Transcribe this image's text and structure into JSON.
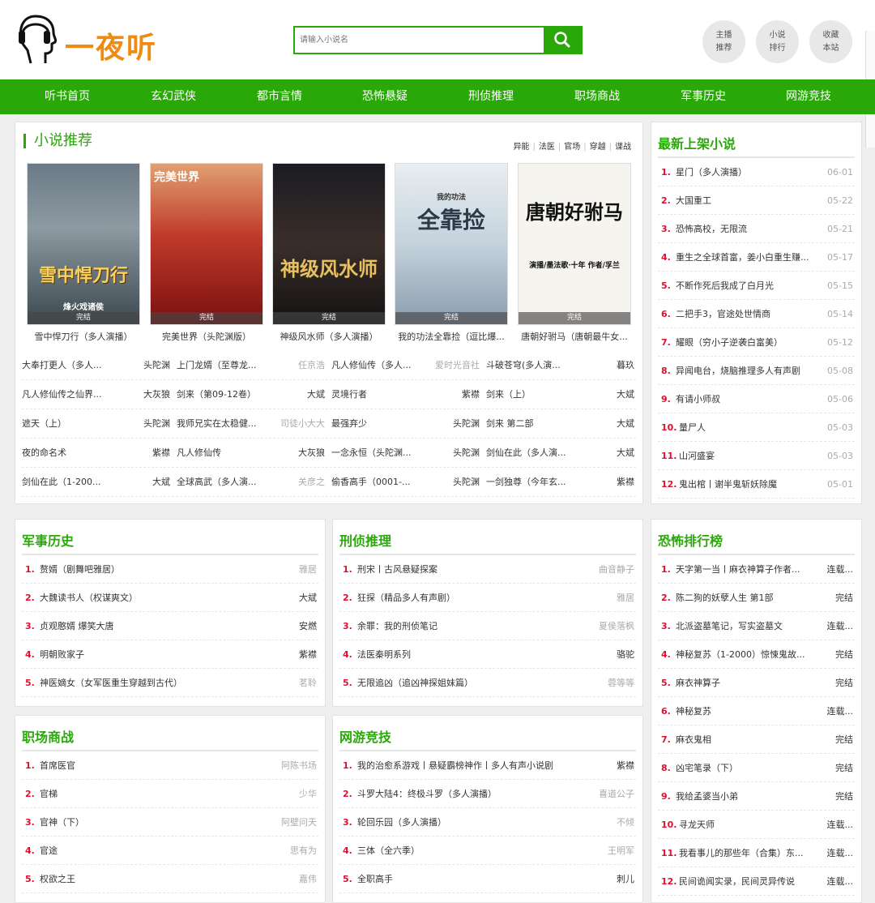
{
  "header": {
    "logo_text": "一夜听",
    "search_placeholder": "请输入小说名",
    "buttons": [
      {
        "line1": "主播",
        "line2": "推荐"
      },
      {
        "line1": "小说",
        "line2": "排行"
      },
      {
        "line1": "收藏",
        "line2": "本站"
      }
    ]
  },
  "nav": [
    "听书首页",
    "玄幻武侠",
    "都市言情",
    "恐怖悬疑",
    "刑侦推理",
    "职场商战",
    "军事历史",
    "网游竞技"
  ],
  "recommend": {
    "title": "小说推荐",
    "tags": [
      "异能",
      "法医",
      "官场",
      "穿越",
      "谍战"
    ],
    "books": [
      {
        "title": "雪中悍刀行（多人演播）",
        "status": "完结",
        "cover_text": "雪中悍刀行",
        "cover_sub": "烽火戏诸侯"
      },
      {
        "title": "完美世界（头陀渊版）",
        "status": "完结",
        "cover_text": "完美世界",
        "cover_sub": ""
      },
      {
        "title": "神级风水师（多人演播）",
        "status": "完结",
        "cover_text": "神级风水师",
        "cover_sub": ""
      },
      {
        "title": "我的功法全靠捡（逗比爆...",
        "status": "完结",
        "cover_text": "全靠捡",
        "cover_sub": "我的功法"
      },
      {
        "title": "唐朝好驸马（唐朝最牛女...",
        "status": "完结",
        "cover_text": "唐朝好驸马",
        "cover_sub": "演播/墨法歌·十年 作者/孚兰"
      }
    ],
    "grid": [
      [
        {
          "n": "大奉打更人（多人...",
          "a": "头陀渊"
        },
        {
          "n": "上门龙婿（至尊龙...",
          "a": "任京浩",
          "gray": true
        },
        {
          "n": "凡人修仙传（多人...",
          "a": "爱时光音社",
          "gray": true
        },
        {
          "n": "斗破苍穹(多人演...",
          "a": "暮玖"
        }
      ],
      [
        {
          "n": "凡人修仙传之仙界...",
          "a": "大灰狼"
        },
        {
          "n": "剑来（第09-12卷）",
          "a": "大斌"
        },
        {
          "n": "灵境行者",
          "a": "紫襟"
        },
        {
          "n": "剑来（上）",
          "a": "大斌"
        }
      ],
      [
        {
          "n": "遮天（上）",
          "a": "头陀渊"
        },
        {
          "n": "我师兄实在太稳健...",
          "a": "司徒小大大",
          "gray": true
        },
        {
          "n": "最强弃少",
          "a": "头陀渊"
        },
        {
          "n": "剑来 第二部",
          "a": "大斌"
        }
      ],
      [
        {
          "n": "夜的命名术",
          "a": "紫襟"
        },
        {
          "n": "凡人修仙传",
          "a": "大灰狼"
        },
        {
          "n": "一念永恒（头陀渊...",
          "a": "头陀渊"
        },
        {
          "n": "剑仙在此（多人演...",
          "a": "大斌"
        }
      ],
      [
        {
          "n": "剑仙在此（1-200...",
          "a": "大斌"
        },
        {
          "n": "全球高武（多人演...",
          "a": "关彦之",
          "gray": true
        },
        {
          "n": "偷香高手（0001-...",
          "a": "头陀渊"
        },
        {
          "n": "一剑独尊（今年玄...",
          "a": "紫襟"
        }
      ]
    ]
  },
  "latest": {
    "title": "最新上架小说",
    "items": [
      {
        "n": "星门（多人演播）",
        "d": "06-01"
      },
      {
        "n": "大国重工",
        "d": "05-22"
      },
      {
        "n": "恐怖高校，无限流",
        "d": "05-21"
      },
      {
        "n": "重生之全球首富，姜小白重生赚...",
        "d": "05-17"
      },
      {
        "n": "不断作死后我成了白月光",
        "d": "05-15"
      },
      {
        "n": "二把手3，官途处世情商",
        "d": "05-14"
      },
      {
        "n": "耀眼（穷小子逆袭白富美）",
        "d": "05-12"
      },
      {
        "n": "异闻电台，烧脑推理多人有声剧",
        "d": "05-08"
      },
      {
        "n": "有请小师叔",
        "d": "05-06"
      },
      {
        "n": "量尸人",
        "d": "05-03"
      },
      {
        "n": "山河盛宴",
        "d": "05-03"
      },
      {
        "n": "鬼出棺丨谢半鬼斩妖除魔",
        "d": "05-01"
      }
    ]
  },
  "military": {
    "title": "军事历史",
    "items": [
      {
        "n": "赘婿（剧舞吧雅居）",
        "a": "雅居"
      },
      {
        "n": "大魏读书人（权谋爽文）",
        "a": "大斌",
        "dark": true
      },
      {
        "n": "贞观憨婿 爆笑大唐",
        "a": "安燃",
        "dark": true
      },
      {
        "n": "明朝败家子",
        "a": "紫襟",
        "dark": true
      },
      {
        "n": "神医嫡女（女军医重生穿越到古代）",
        "a": "茗聆"
      }
    ]
  },
  "detective": {
    "title": "刑侦推理",
    "items": [
      {
        "n": "刑宋丨古风悬疑探案",
        "a": "曲音静子"
      },
      {
        "n": "狂探（精品多人有声剧）",
        "a": "雅居"
      },
      {
        "n": "余罪：我的刑侦笔记",
        "a": "夏侯落枫"
      },
      {
        "n": "法医秦明系列",
        "a": "骆驼",
        "dark": true
      },
      {
        "n": "无限追凶（追凶神探姐妹篇）",
        "a": "蓉等等"
      }
    ]
  },
  "horror": {
    "title": "恐怖排行榜",
    "items": [
      {
        "n": "天字第一当丨麻衣神算子作者...",
        "a": "连载..."
      },
      {
        "n": "陈二狗的妖孽人生 第1部",
        "a": "完结"
      },
      {
        "n": "北派盗墓笔记，写实盗墓文",
        "a": "连载..."
      },
      {
        "n": "神秘复苏（1-2000）惊悚鬼故...",
        "a": "完结"
      },
      {
        "n": "麻衣神算子",
        "a": "完结"
      },
      {
        "n": "神秘复苏",
        "a": "连载..."
      },
      {
        "n": "麻衣鬼相",
        "a": "完结"
      },
      {
        "n": "凶宅笔录（下）",
        "a": "完结"
      },
      {
        "n": "我给孟婆当小弟",
        "a": "完结"
      },
      {
        "n": "寻龙天师",
        "a": "连载..."
      },
      {
        "n": "我看事儿的那些年（合集）东...",
        "a": "连载..."
      },
      {
        "n": "民间诡闻实录，民间灵异传说",
        "a": "连载..."
      }
    ]
  },
  "business": {
    "title": "职场商战",
    "items": [
      {
        "n": "首席医官",
        "a": "阿陈书场"
      },
      {
        "n": "官梯",
        "a": "少华"
      },
      {
        "n": "官神（下）",
        "a": "阿壁问天"
      },
      {
        "n": "官途",
        "a": "思有为"
      },
      {
        "n": "权欲之王",
        "a": "嘉伟"
      }
    ]
  },
  "gaming": {
    "title": "网游竞技",
    "items": [
      {
        "n": "我的治愈系游戏丨悬疑霸榜神作丨多人有声小说剧",
        "a": "紫襟",
        "dark": true
      },
      {
        "n": "斗罗大陆4：终极斗罗（多人演播）",
        "a": "喜道公子"
      },
      {
        "n": "轮回乐园（多人演播）",
        "a": "不倾"
      },
      {
        "n": "三体（全六季）",
        "a": "王明军"
      },
      {
        "n": "全职高手",
        "a": "刺儿",
        "dark": true
      }
    ]
  }
}
